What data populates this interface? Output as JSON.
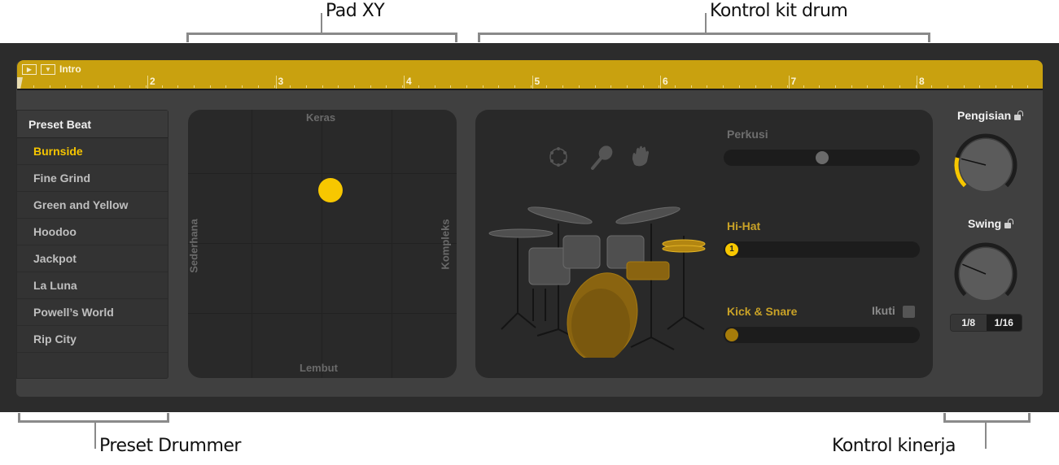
{
  "callouts": {
    "top": [
      {
        "label": "Pad XY"
      },
      {
        "label": "Kontrol kit drum"
      }
    ],
    "bottom": [
      {
        "label": "Preset Drummer"
      },
      {
        "label": "Kontrol kinerja"
      }
    ]
  },
  "ruler": {
    "region_name": "Intro",
    "icons": [
      "play-region-icon",
      "follow-region-icon"
    ],
    "bars": [
      "2",
      "3",
      "4",
      "5",
      "6",
      "7",
      "8"
    ],
    "color": "#c9a10f"
  },
  "presets": {
    "header": "Preset Beat",
    "selected_index": 0,
    "items": [
      {
        "label": "Burnside"
      },
      {
        "label": "Fine Grind"
      },
      {
        "label": "Green and Yellow"
      },
      {
        "label": "Hoodoo"
      },
      {
        "label": "Jackpot"
      },
      {
        "label": "La Luna"
      },
      {
        "label": "Powell’s World"
      },
      {
        "label": "Rip City"
      }
    ]
  },
  "xypad": {
    "top_label": "Keras",
    "bottom_label": "Lembut",
    "left_label": "Sederhana",
    "right_label": "Kompleks",
    "puck": {
      "complexity": 0.53,
      "loudness": 0.7
    },
    "puck_color": "#f7c700"
  },
  "kit": {
    "percussion_icons": [
      "tambourine-icon",
      "shaker-icon",
      "handclap-icon"
    ],
    "sliders": [
      {
        "label": "Perkusi",
        "value": 0.5,
        "active": false,
        "thumb_text": ""
      },
      {
        "label": "Hi-Hat",
        "value": 0.0,
        "active": true,
        "thumb_text": "1"
      },
      {
        "label": "Kick & Snare",
        "value": 0.0,
        "active": true,
        "thumb_text": ""
      }
    ],
    "follow_label": "Ikuti",
    "follow_checked": false,
    "accent_color": "#c9a227"
  },
  "performance": {
    "fills": {
      "label": "Pengisian",
      "value": 0.22,
      "locked": false
    },
    "swing": {
      "label": "Swing",
      "value": 0.25,
      "locked": false
    },
    "swing_resolution": {
      "options": [
        "1/8",
        "1/16"
      ],
      "selected": "1/16"
    }
  }
}
